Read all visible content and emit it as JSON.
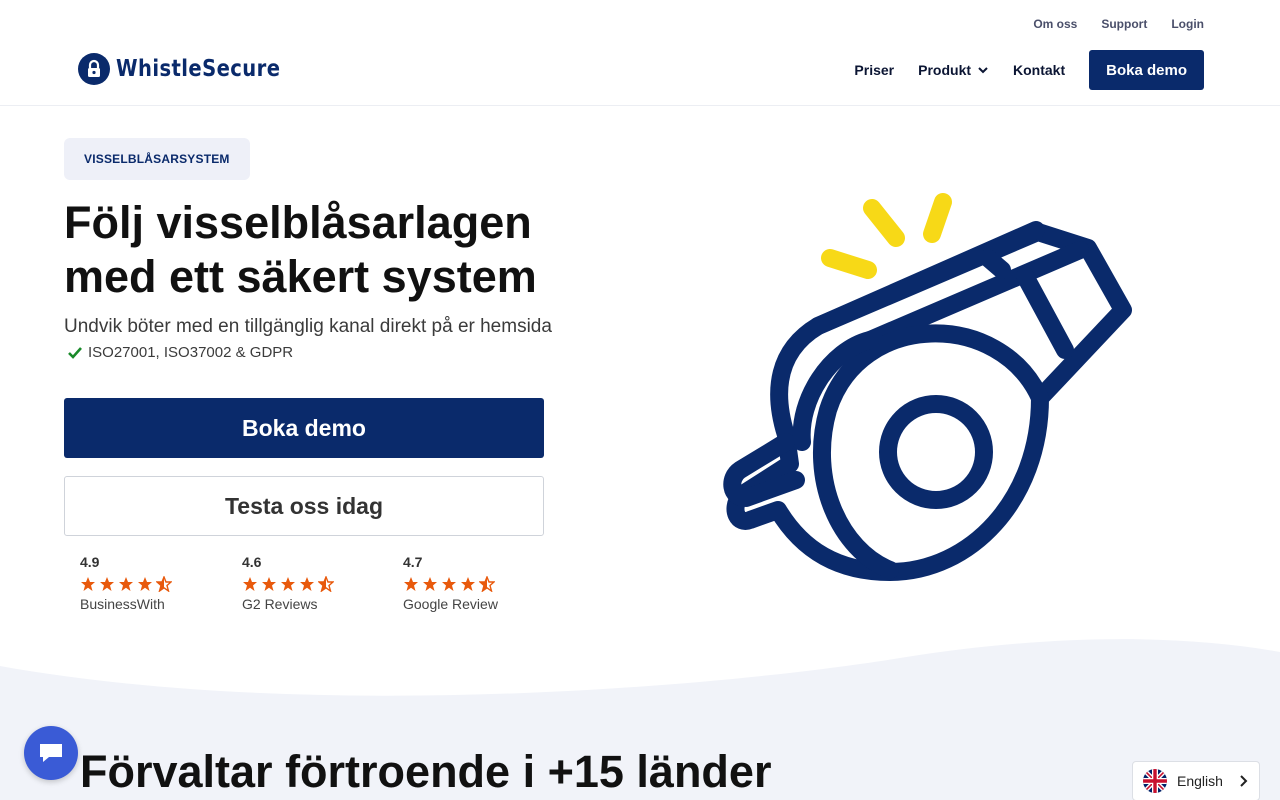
{
  "header": {
    "brand": "WhistleSecure",
    "top_links": [
      "Om oss",
      "Support",
      "Login"
    ],
    "nav": {
      "priser": "Priser",
      "produkt": "Produkt",
      "kontakt": "Kontakt",
      "cta": "Boka demo"
    }
  },
  "hero": {
    "badge": "VISSELBLÅSARSYSTEM",
    "title_line1": "Följ visselblåsarlagen",
    "title_line2": "med ett säkert system",
    "subtitle": "Undvik böter med en tillgänglig kanal direkt på er hemsida",
    "compliance": "ISO27001, ISO37002 & GDPR",
    "primary_cta": "Boka demo",
    "secondary_cta": "Testa oss idag",
    "ratings": [
      {
        "score": "4.9",
        "source": "BusinessWith",
        "stars": 4.5
      },
      {
        "score": "4.6",
        "source": "G2 Reviews",
        "stars": 4.5
      },
      {
        "score": "4.7",
        "source": "Google Review",
        "stars": 4.5
      }
    ]
  },
  "section2": {
    "title": "Förvaltar förtroende i +15 länder"
  },
  "language": {
    "selected": "English"
  },
  "colors": {
    "brand_navy": "#0a2a6b",
    "star_orange": "#e8590c",
    "accent_yellow": "#f7d917",
    "check_green": "#1a8a2a",
    "chat_blue": "#3a5bd6"
  },
  "icons": [
    "lock-icon",
    "chevron-down-icon",
    "check-icon",
    "star-icon",
    "whistle-illustration",
    "chat-icon",
    "uk-flag-icon",
    "chevron-right-icon"
  ]
}
